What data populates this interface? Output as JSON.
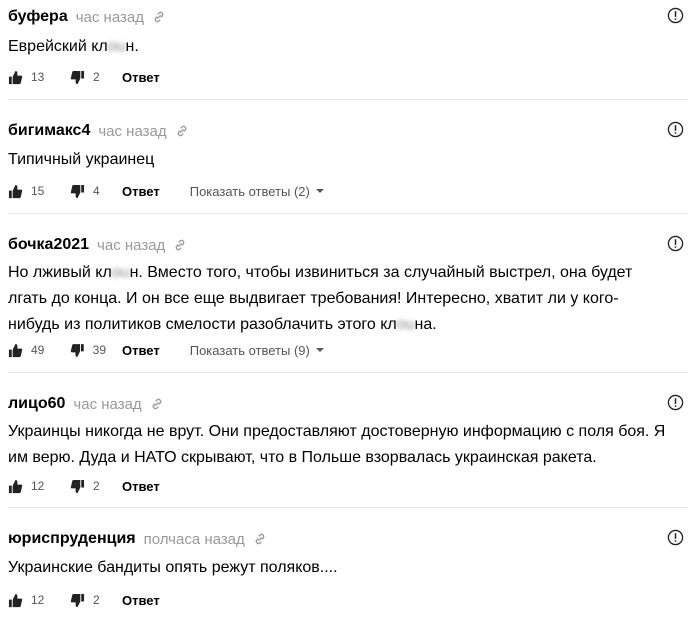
{
  "comments": [
    {
      "author": "буфера",
      "time": "час назад",
      "text_parts": [
        "Еврейский кл",
        "ou",
        "н."
      ],
      "likes": "13",
      "dislikes": "2",
      "reply": "Ответ"
    },
    {
      "author": "бигимакс4",
      "time": "час назад",
      "text": "Типичный украинец",
      "likes": "15",
      "dislikes": "4",
      "reply": "Ответ",
      "show_replies": "Показать ответы (2)"
    },
    {
      "author": "бочка2021",
      "time": "час назад",
      "text_parts": [
        "Но лживый кл",
        "ou",
        "н. Вместо того, чтобы извиниться за случайный выстрел, она будет лгать до конца. И он все еще выдвигает требования! Интересно, хватит ли у кого-нибудь из политиков смелости разоблачить этого кл",
        "ou",
        "на."
      ],
      "likes": "49",
      "dislikes": "39",
      "reply": "Ответ",
      "show_replies": "Показать ответы (9)"
    },
    {
      "author": "лицо60",
      "time": "час назад",
      "text": "Украинцы никогда не врут. Они предоставляют достоверную информацию с поля боя. Я им верю. Дуда и НАТО скрывают, что в Польше взорвалась украинская ракета.",
      "likes": "12",
      "dislikes": "2",
      "reply": "Ответ"
    },
    {
      "author": "юриспруденция",
      "time": "полчаса назад",
      "text": "Украинские бандиты опять режут поляков....",
      "likes": "12",
      "dislikes": "2",
      "reply": "Ответ"
    }
  ],
  "icons": {
    "like": "thumbs-up-icon",
    "dislike": "thumbs-down-icon",
    "link": "link-icon",
    "report": "report-icon"
  },
  "colors": {
    "muted": "#999999",
    "divider": "#e6e6e6"
  }
}
